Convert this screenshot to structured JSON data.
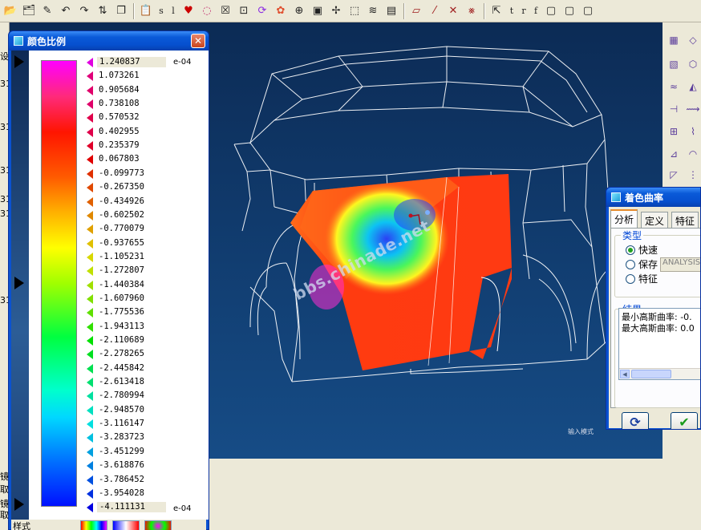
{
  "toolbar": {
    "text_buttons": [
      "s",
      "l",
      "t",
      "r",
      "f"
    ]
  },
  "left_strip": {
    "fragments": [
      "设",
      "31",
      "31",
      "31",
      "31",
      "31",
      "31",
      "镜",
      "取",
      "镜",
      "取"
    ]
  },
  "viewport": {
    "watermark": "bbs.chinade.net",
    "mode_label": "输入模式"
  },
  "color_scale": {
    "title": "颜色比例",
    "exponent": "e-04",
    "values": [
      "1.240837",
      "1.073261",
      "0.905684",
      "0.738108",
      "0.570532",
      "0.402955",
      "0.235379",
      "0.067803",
      "-0.099773",
      "-0.267350",
      "-0.434926",
      "-0.602502",
      "-0.770079",
      "-0.937655",
      "-1.105231",
      "-1.272807",
      "-1.440384",
      "-1.607960",
      "-1.775536",
      "-1.943113",
      "-2.110689",
      "-2.278265",
      "-2.445842",
      "-2.613418",
      "-2.780994",
      "-2.948570",
      "-3.116147",
      "-3.283723",
      "-3.451299",
      "-3.618876",
      "-3.786452",
      "-3.954028",
      "-4.111131"
    ],
    "arrow_colors": [
      "#e000e0",
      "#e0007a",
      "#e0006a",
      "#e0006a",
      "#e0004a",
      "#e0004a",
      "#e0002a",
      "#e00000",
      "#e03000",
      "#e04800",
      "#e06000",
      "#e08800",
      "#e0a000",
      "#e0c000",
      "#d8d800",
      "#c0e000",
      "#a0e000",
      "#80e000",
      "#60e000",
      "#30e000",
      "#00e000",
      "#00e020",
      "#00e050",
      "#00e070",
      "#00e0a0",
      "#00e0c0",
      "#00e0e0",
      "#00c0e0",
      "#00a0e0",
      "#0080e0",
      "#0050e0",
      "#0030e0",
      "#0000e0"
    ],
    "footer_label": "样式"
  },
  "curvature": {
    "title": "着色曲率",
    "tabs": [
      "分析",
      "定义",
      "特征"
    ],
    "type_label": "类型",
    "options": [
      "快速",
      "保存",
      "特征"
    ],
    "analysis_name": "ANALYSIS_",
    "results_label": "结果",
    "results": [
      "最小高斯曲率: -0.",
      "最大高斯曲率: 0.0"
    ]
  },
  "colors": {
    "accent": "#0a52d1",
    "viewport_bg": "#103a6c"
  }
}
